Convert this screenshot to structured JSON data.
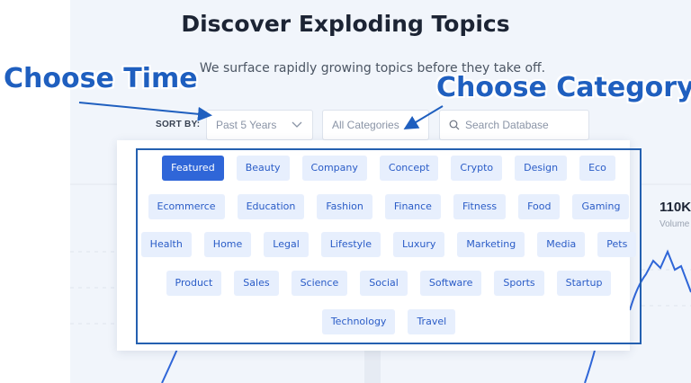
{
  "header": {
    "title": "Discover Exploding Topics",
    "subtitle": "We surface rapidly growing topics before they take off."
  },
  "annotations": {
    "time": "Choose Time",
    "category": "Choose Category"
  },
  "filters": {
    "sort_label": "SORT BY:",
    "time_value": "Past 5 Years",
    "category_value": "All Categories",
    "search_placeholder": "Search Database"
  },
  "categories": {
    "row1": [
      "Featured",
      "Beauty",
      "Company",
      "Concept",
      "Crypto",
      "Design",
      "Eco"
    ],
    "row2": [
      "Ecommerce",
      "Education",
      "Fashion",
      "Finance",
      "Fitness",
      "Food",
      "Gaming"
    ],
    "row3": [
      "Health",
      "Home",
      "Legal",
      "Lifestyle",
      "Luxury",
      "Marketing",
      "Media",
      "Pets"
    ],
    "row4": [
      "Product",
      "Sales",
      "Science",
      "Social",
      "Software",
      "Sports",
      "Startup"
    ],
    "row5": [
      "Technology",
      "Travel"
    ],
    "selected": "Featured"
  },
  "background_card": {
    "stat": "110K",
    "stat_label": "Volume"
  },
  "colors": {
    "accent": "#2f66d8",
    "chip_bg": "#e7effd",
    "annotation": "#1f5fbf"
  }
}
